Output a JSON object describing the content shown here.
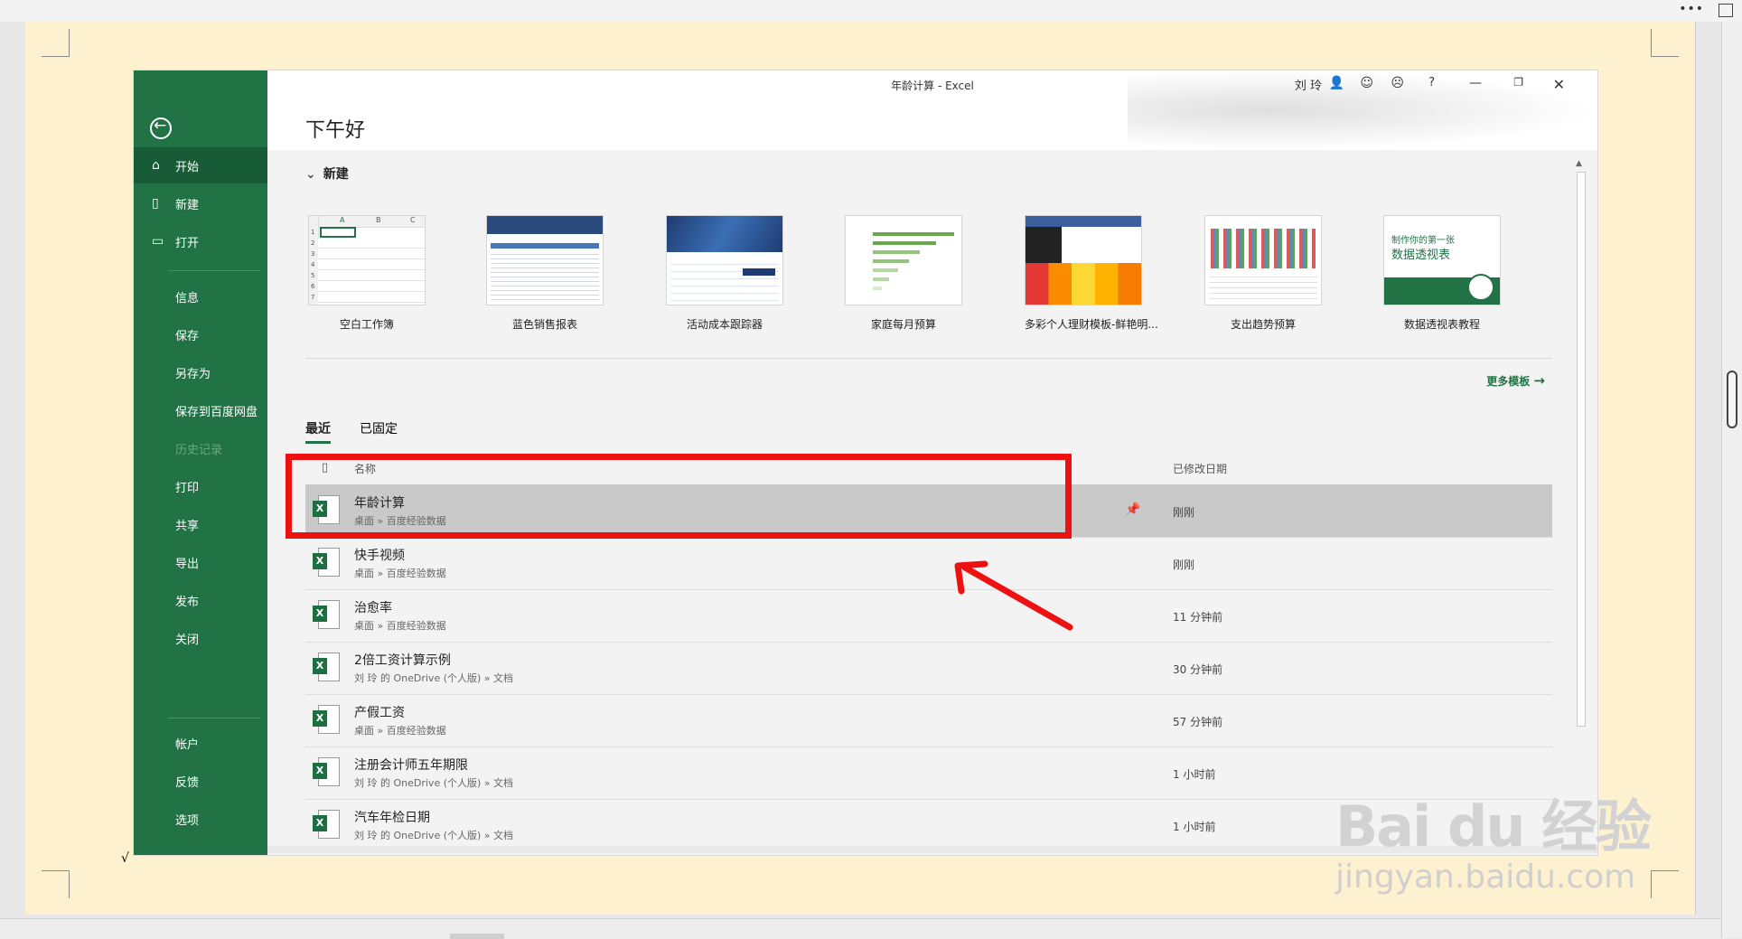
{
  "window": {
    "title": "年龄计算  -  Excel",
    "user": "刘 玲",
    "greeting": "下午好"
  },
  "sidebar": {
    "items": [
      {
        "label": "开始",
        "icon": "home-icon",
        "active": true
      },
      {
        "label": "新建",
        "icon": "new-doc-icon"
      },
      {
        "label": "打开",
        "icon": "folder-open-icon"
      },
      {
        "label": "信息"
      },
      {
        "label": "保存"
      },
      {
        "label": "另存为"
      },
      {
        "label": "保存到百度网盘"
      },
      {
        "label": "历史记录",
        "disabled": true
      },
      {
        "label": "打印"
      },
      {
        "label": "共享"
      },
      {
        "label": "导出"
      },
      {
        "label": "发布"
      },
      {
        "label": "关闭"
      },
      {
        "label": "帐户"
      },
      {
        "label": "反馈"
      },
      {
        "label": "选项"
      }
    ]
  },
  "new_section": {
    "title": "新建",
    "templates": [
      {
        "name": "空白工作簿"
      },
      {
        "name": "蓝色销售报表"
      },
      {
        "name": "活动成本跟踪器"
      },
      {
        "name": "家庭每月预算"
      },
      {
        "name": "多彩个人理财模板-鲜艳明..."
      },
      {
        "name": "支出趋势预算"
      },
      {
        "name": "数据透视表教程",
        "thumb_text1": "制作你的第一张",
        "thumb_text2": "数据透视表"
      }
    ],
    "more_templates": "更多模板"
  },
  "recent": {
    "tabs": [
      "最近",
      "已固定"
    ],
    "col_name": "名称",
    "col_date": "已修改日期",
    "files": [
      {
        "name": "年龄计算",
        "path": "桌面 » 百度经验数据",
        "date": "刚刚",
        "selected": true
      },
      {
        "name": "快手视频",
        "path": "桌面 » 百度经验数据",
        "date": "刚刚"
      },
      {
        "name": "治愈率",
        "path": "桌面 » 百度经验数据",
        "date": "11 分钟前"
      },
      {
        "name": "2倍工资计算示例",
        "path": "刘 玲 的 OneDrive (个人版) » 文档",
        "date": "30 分钟前"
      },
      {
        "name": "产假工资",
        "path": "桌面 » 百度经验数据",
        "date": "57 分钟前"
      },
      {
        "name": "注册会计师五年期限",
        "path": "刘 玲 的 OneDrive (个人版) » 文档",
        "date": "1 小时前"
      },
      {
        "name": "汽车年检日期",
        "path": "刘 玲 的 OneDrive (个人版) » 文档",
        "date": "1 小时前"
      }
    ]
  },
  "thumb_labels": {
    "blank_cols": [
      "A",
      "B",
      "C"
    ],
    "blank_rows": [
      "1",
      "2",
      "3",
      "4",
      "5",
      "6",
      "7"
    ]
  },
  "outer": {
    "check_mark": "√",
    "dots": "•••"
  },
  "watermark": {
    "line1": "Bai du 经验",
    "line2": "jingyan.baidu.com"
  },
  "colors": {
    "excel_green": "#217346",
    "annotation_red": "#ee1111"
  }
}
